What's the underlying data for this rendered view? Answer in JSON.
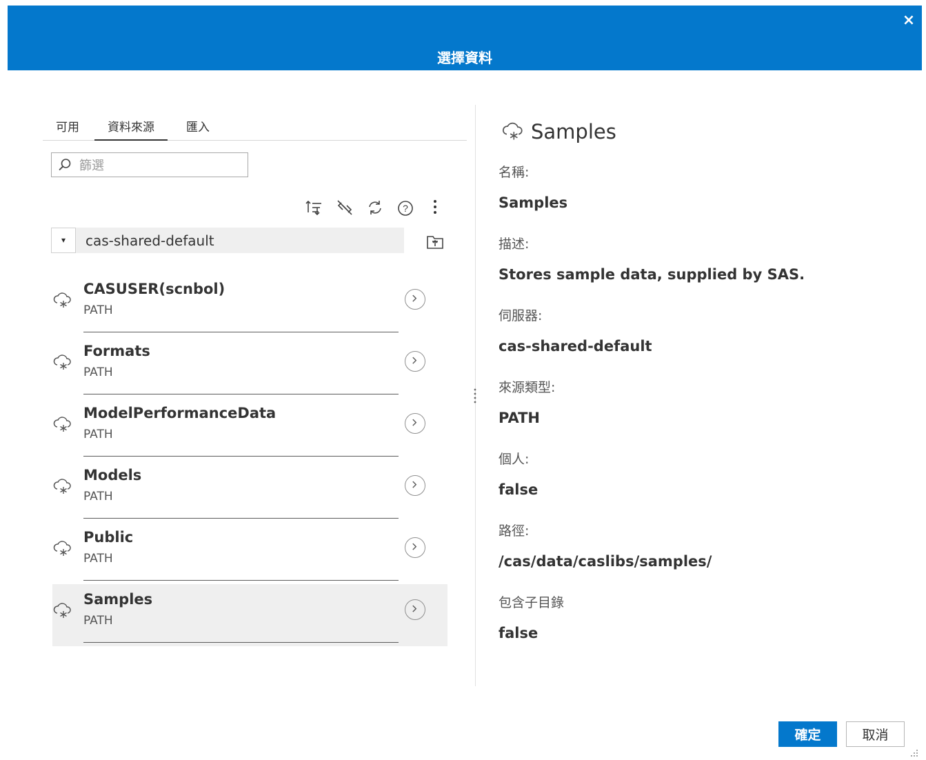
{
  "dialog": {
    "title": "選擇資料",
    "close_label": "×"
  },
  "tabs": [
    {
      "label": "可用",
      "active": false
    },
    {
      "label": "資料來源",
      "active": true
    },
    {
      "label": "匯入",
      "active": false
    }
  ],
  "filter": {
    "placeholder": "篩選",
    "value": ""
  },
  "toolbar": {
    "icons": [
      "sort-icon",
      "unlink-icon",
      "refresh-icon",
      "help-icon",
      "more-options-icon"
    ]
  },
  "server": {
    "selected": "cas-shared-default",
    "caret": "▾"
  },
  "libraries": [
    {
      "name": "CASUSER(scnbol)",
      "type": "PATH",
      "selected": false
    },
    {
      "name": "Formats",
      "type": "PATH",
      "selected": false
    },
    {
      "name": "ModelPerformanceData",
      "type": "PATH",
      "selected": false
    },
    {
      "name": "Models",
      "type": "PATH",
      "selected": false
    },
    {
      "name": "Public",
      "type": "PATH",
      "selected": false
    },
    {
      "name": "Samples",
      "type": "PATH",
      "selected": true
    }
  ],
  "details": {
    "title": "Samples",
    "fields": [
      {
        "label": "名稱:",
        "value": "Samples"
      },
      {
        "label": "描述:",
        "value": "Stores sample data, supplied by SAS."
      },
      {
        "label": "伺服器:",
        "value": "cas-shared-default"
      },
      {
        "label": "來源類型:",
        "value": "PATH"
      },
      {
        "label": "個人:",
        "value": "false"
      },
      {
        "label": "路徑:",
        "value": "/cas/data/caslibs/samples/"
      },
      {
        "label": "包含子目錄",
        "value": "false"
      }
    ]
  },
  "footer": {
    "ok_label": "確定",
    "cancel_label": "取消"
  },
  "colors": {
    "accent": "#0478cc",
    "selected_row": "#efefef"
  }
}
